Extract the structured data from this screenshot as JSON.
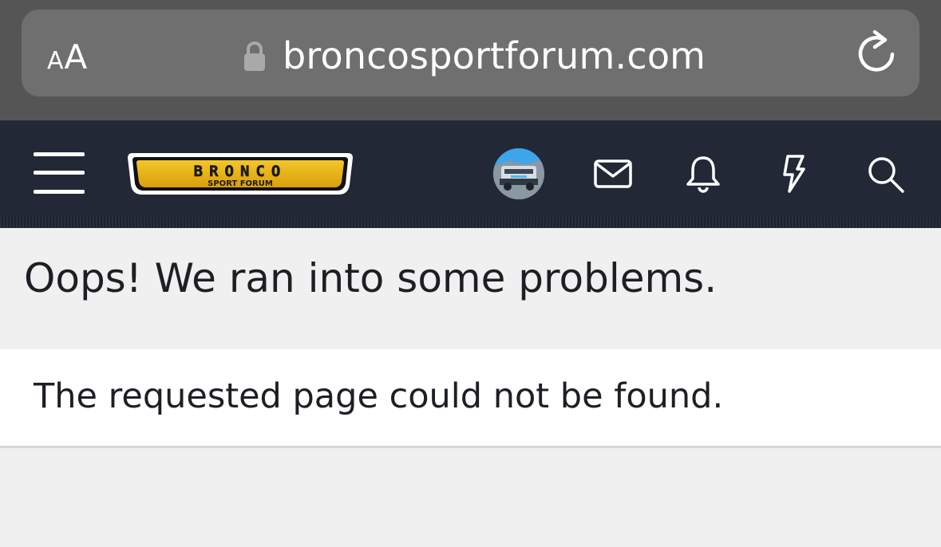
{
  "browser": {
    "text_size_small": "A",
    "text_size_big": "A",
    "url": "broncosportforum.com",
    "lock_icon": "lock-icon",
    "reload_icon": "reload-icon"
  },
  "header": {
    "menu_icon": "hamburger-menu-icon",
    "logo": {
      "title": "BRONCO",
      "subtitle": "SPORT FORUM",
      "badge_color": "#e8b417"
    },
    "icons": [
      "avatar",
      "envelope-icon",
      "bell-icon",
      "lightning-icon",
      "search-icon"
    ],
    "background": "#222836"
  },
  "main": {
    "title": "Oops! We ran into some problems.",
    "message": "The requested page could not be found."
  }
}
